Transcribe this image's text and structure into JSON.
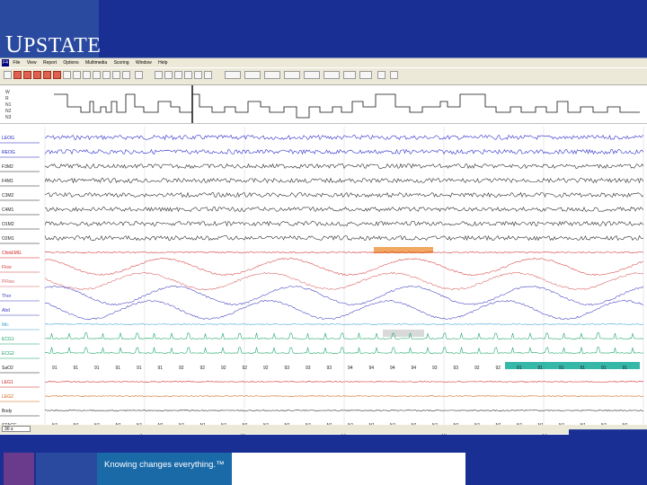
{
  "brand": {
    "name_first": "U",
    "name_rest": "PSTATE",
    "tagline": "Knowing changes everything.™"
  },
  "menu": [
    "File",
    "View",
    "Report",
    "Options",
    "Multimedia",
    "Scoring",
    "Window",
    "Help"
  ],
  "hypnogram_scale": [
    "W",
    "R",
    "N1",
    "N2",
    "N3"
  ],
  "channels": [
    {
      "label": "LEOG",
      "color": "#1c1cc8"
    },
    {
      "label": "REOG",
      "color": "#1c1cc8"
    },
    {
      "label": "F3M2",
      "color": "#1c1c1c"
    },
    {
      "label": "F4M1",
      "color": "#1c1c1c"
    },
    {
      "label": "C3M2",
      "color": "#1c1c1c"
    },
    {
      "label": "C4M1",
      "color": "#1c1c1c"
    },
    {
      "label": "O1M2",
      "color": "#1c1c1c"
    },
    {
      "label": "O2M1",
      "color": "#1c1c1c"
    },
    {
      "label": "ChinEMG",
      "color": "#d02020"
    },
    {
      "label": "Flow",
      "color": "#d84040"
    },
    {
      "label": "PFlow",
      "color": "#d86060"
    },
    {
      "label": "Thor",
      "color": "#3c3cc0"
    },
    {
      "label": "Abd",
      "color": "#3c3cc0"
    },
    {
      "label": "Mic",
      "color": "#3ca0d0"
    },
    {
      "label": "ECG1",
      "color": "#10a060"
    },
    {
      "label": "ECG2",
      "color": "#10a060"
    },
    {
      "label": "SaO2",
      "color": "#1c1c1c"
    },
    {
      "label": "LEG1",
      "color": "#d02020"
    },
    {
      "label": "LEG2",
      "color": "#d06010"
    },
    {
      "label": "Body",
      "color": "#1c1c1c"
    },
    {
      "label": "STAGE",
      "color": "#1c1c1c"
    }
  ],
  "sao2_values": [
    "91",
    "91",
    "91",
    "91",
    "91",
    "91",
    "92",
    "92",
    "92",
    "92",
    "92",
    "93",
    "93",
    "93",
    "94",
    "94",
    "94",
    "94",
    "93",
    "93",
    "92",
    "92",
    "91",
    "91",
    "91",
    "91",
    "91",
    "91"
  ],
  "stage_values": [
    "N1",
    "N1",
    "N1",
    "N1",
    "N1",
    "N1",
    "N1",
    "N1",
    "N1",
    "N1",
    "N1",
    "N1",
    "N1",
    "N1",
    "N1",
    "N1",
    "N1",
    "N1",
    "N1",
    "N1",
    "N1",
    "N1",
    "N1",
    "N1",
    "N1",
    "N1",
    "N1",
    "N1"
  ],
  "time_ticks": [
    "5\"",
    "10\"",
    "15\"",
    "20\"",
    "25\""
  ],
  "status": {
    "epoch_box": "30 s"
  },
  "colors": {
    "brand_navy": "#1a2f93",
    "accent_blue": "#1a6aa8",
    "accent_purple": "#6a3a8c",
    "event_orange": "#f0a050",
    "event_teal": "#20b0a0"
  }
}
